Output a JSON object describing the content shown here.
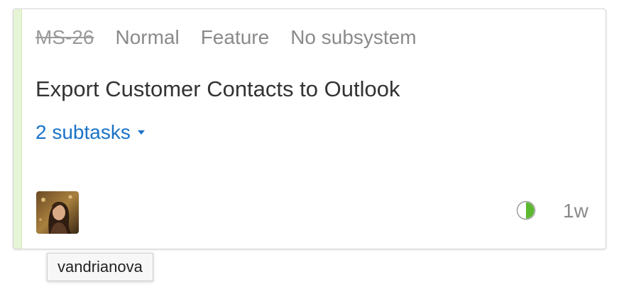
{
  "card": {
    "issue_id": "MS-26",
    "priority": "Normal",
    "type": "Feature",
    "subsystem": "No subsystem",
    "summary": "Export Customer Contacts to Outlook",
    "subtasks_label": "2 subtasks",
    "estimate": "1w",
    "progress_fraction": 0.5,
    "colors": {
      "stripe": "#e6f4d6",
      "link": "#1a73c8",
      "progress": "#5cb82e"
    },
    "icons": {
      "subtasks_toggle": "chevron-down-icon",
      "progress": "progress-pie-icon",
      "assignee": "avatar"
    }
  },
  "tooltip": {
    "text": "vandrianova"
  }
}
